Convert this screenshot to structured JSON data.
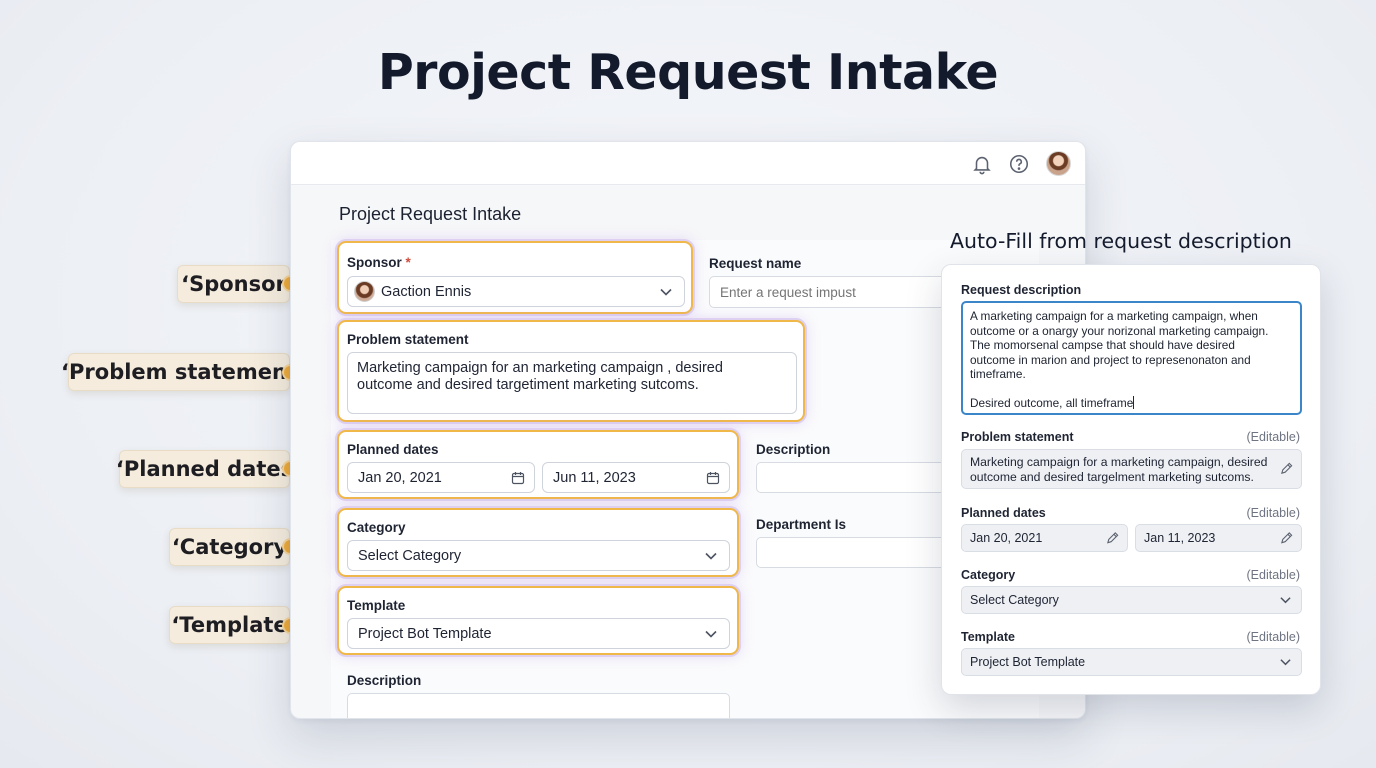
{
  "page": {
    "headline": "Project Request Intake"
  },
  "window": {
    "form_title": "Project Request Intake",
    "topbar_icons": [
      "bell-icon",
      "help-icon",
      "avatar"
    ]
  },
  "form": {
    "sponsor": {
      "label": "Sponsor",
      "required_mark": "*",
      "value": "Gaction Ennis"
    },
    "request_name": {
      "label": "Request name",
      "placeholder": "Enter a request impust"
    },
    "problem_statement": {
      "label": "Problem statement",
      "value": "Marketing campaign for an marketing campaign , desired outcome and desired targetiment marketing sutcoms."
    },
    "planned_dates": {
      "label": "Planned dates",
      "start": "Jan 20, 2021",
      "end": "Jun 11, 2023"
    },
    "description_right": {
      "label": "Description"
    },
    "department": {
      "label": "Department Is"
    },
    "category": {
      "label": "Category",
      "value": "Select Category"
    },
    "template": {
      "label": "Template",
      "value": "Project Bot Template"
    },
    "description_bottom": {
      "label": "Description"
    }
  },
  "callouts": [
    "‘Sponsor",
    "‘Problem statement",
    "‘Planned dates",
    "‘Category",
    "‘Template"
  ],
  "autofill": {
    "title": "Auto-Fill from request description",
    "request_description": {
      "label": "Request description",
      "text": "A marketing campaign for a marketing campaign, when\noutcome or a onargy your norizonal marketing campaign.\nThe momorsenal campse that should have desired\noutcome in marion and project to represenonaton and\ntimeframe.",
      "last_line": "Desired outcome, all timeframe"
    },
    "problem_statement": {
      "label": "Problem statement",
      "tag": "(Editable)",
      "value": "Marketing campaign for a marketing campaign, desired outcome and desired targelment marketing sutcoms."
    },
    "planned_dates": {
      "label": "Planned dates",
      "tag": "(Editable)",
      "start": "Jan 20, 2021",
      "end": "Jan 11, 2023"
    },
    "category": {
      "label": "Category",
      "tag": "(Editable)",
      "value": "Select Category"
    },
    "template": {
      "label": "Template",
      "tag": "(Editable)",
      "value": "Project Bot Template"
    }
  },
  "colors": {
    "highlight_border": "#f0b848",
    "highlight_glow": "#ddd0f1",
    "callout_bg": "#f5ecdd",
    "focus_blue": "#3a86c8"
  }
}
